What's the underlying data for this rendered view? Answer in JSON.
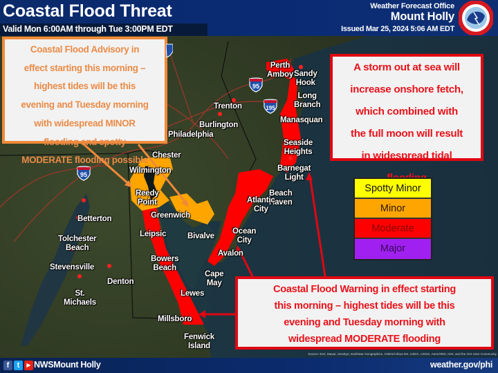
{
  "header": {
    "title": "Coastal Flood Threat",
    "valid_period": "Valid Mon 6:00AM through Tue 3:00PM EDT",
    "office_label": "Weather Forecast Office",
    "office_name": "Mount Holly",
    "issued": "Issued Mar 25, 2024 5:06 AM EDT",
    "logo": "nws-logo-icon"
  },
  "callouts": {
    "advisory": {
      "lines": [
        "Coastal Flood Advisory in",
        "effect starting this morning –",
        "highest tides will be this",
        "evening and Tuesday morning",
        "with widespread MINOR",
        "flooding and spotty",
        "MODERATE flooding possible"
      ],
      "color": "#ea8b47"
    },
    "storm": {
      "lines": [
        "A storm out at sea will",
        "increase onshore fetch,",
        "which combined with",
        "the full moon will result",
        "in widespread tidal",
        "flooding"
      ],
      "color": "#e8131b"
    },
    "warning": {
      "lines": [
        "Coastal Flood Warning in effect starting",
        "this morning – highest tides will be this",
        "evening and Tuesday morning with",
        "widespread MODERATE flooding"
      ],
      "color": "#e8131b"
    }
  },
  "legend": {
    "items": [
      {
        "label": "Spotty Minor",
        "color": "#ffff00",
        "text_color": "#111111"
      },
      {
        "label": "Minor",
        "color": "#ffa500",
        "text_color": "#2a1a00"
      },
      {
        "label": "Moderate",
        "color": "#ff0000",
        "text_color": "#8a0000"
      },
      {
        "label": "Major",
        "color": "#a020f0",
        "text_color": "#3a0a55"
      }
    ]
  },
  "places": [
    {
      "name": "Perth\nAmboy"
    },
    {
      "name": "Sandy\nHook"
    },
    {
      "name": "Long\nBranch"
    },
    {
      "name": "Trenton"
    },
    {
      "name": "Burlington"
    },
    {
      "name": "Philadelphia"
    },
    {
      "name": "Manasquan"
    },
    {
      "name": "Seaside\nHeights"
    },
    {
      "name": "Chester"
    },
    {
      "name": "Wilmington"
    },
    {
      "name": "Barnegat\nLight"
    },
    {
      "name": "Beach\nHaven"
    },
    {
      "name": "Reedy\nPoint"
    },
    {
      "name": "Greenwich"
    },
    {
      "name": "Atlantic\nCity"
    },
    {
      "name": "Betterton"
    },
    {
      "name": "Leipsic"
    },
    {
      "name": "Bivalve"
    },
    {
      "name": "Ocean\nCity"
    },
    {
      "name": "Tolchester\nBeach"
    },
    {
      "name": "Avalon"
    },
    {
      "name": "Bowers\nBeach"
    },
    {
      "name": "Stevensville"
    },
    {
      "name": "Cape\nMay"
    },
    {
      "name": "Denton"
    },
    {
      "name": "St.\nMichaels"
    },
    {
      "name": "Lewes"
    },
    {
      "name": "Millsboro"
    },
    {
      "name": "Fenwick\nIsland"
    }
  ],
  "shields": [
    {
      "route": "95"
    },
    {
      "route": "195"
    },
    {
      "route": "95"
    },
    {
      "route": "95"
    }
  ],
  "footer": {
    "handle": "NWSMount Holly",
    "website": "weather.gov/phi",
    "credit": "Source: Esri, Maxar, GeoEye, Earthstar Geographics, CNES/Airbus DS, USDA, USGS, AeroGRID, IGN, and the GIS User Community",
    "social_icons": [
      "facebook-icon",
      "twitter-icon",
      "youtube-icon"
    ]
  }
}
